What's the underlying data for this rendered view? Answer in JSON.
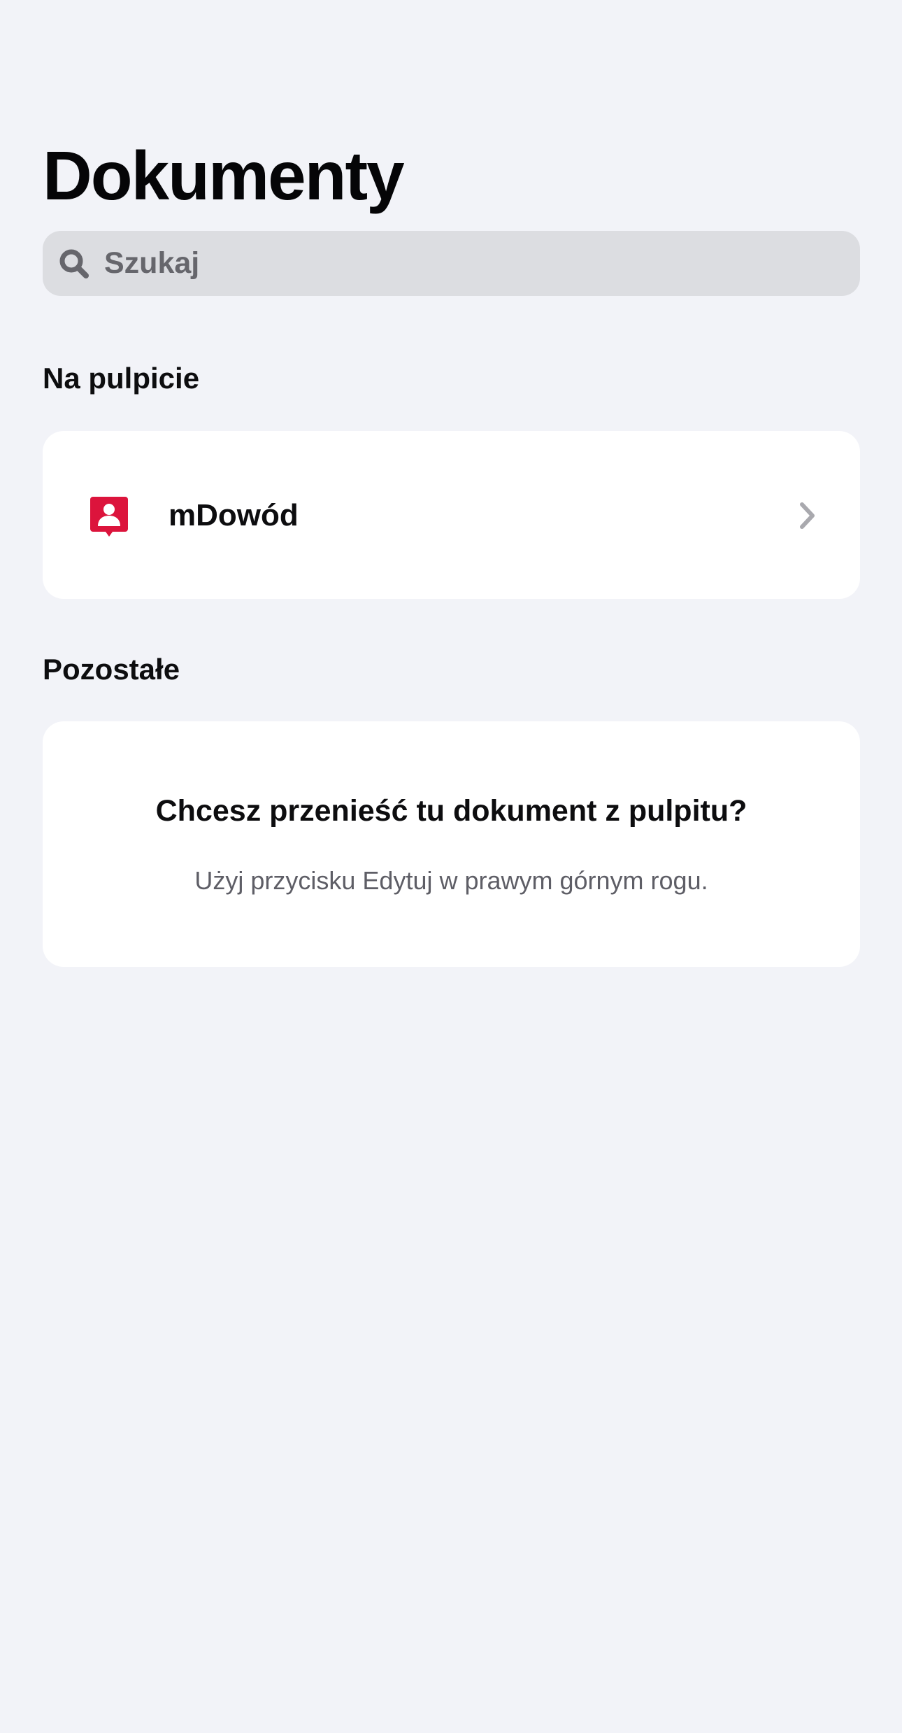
{
  "header": {
    "title": "Dokumenty"
  },
  "search": {
    "placeholder": "Szukaj",
    "value": "",
    "icon": "search-icon"
  },
  "sections": {
    "desktop": {
      "title": "Na pulpicie",
      "items": [
        {
          "label": "mDowód",
          "icon": "id-card-icon",
          "icon_color": "#dc143c",
          "action_icon": "chevron-right-icon"
        }
      ]
    },
    "other": {
      "title": "Pozostałe",
      "empty_state": {
        "title": "Chcesz przenieść tu dokument z pulpitu?",
        "subtitle": "Użyj przycisku Edytuj w prawym górnym rogu."
      }
    }
  },
  "colors": {
    "background": "#f2f3f8",
    "card": "#ffffff",
    "search_bg": "#dcdde1",
    "accent_red": "#dc143c",
    "secondary_text": "#5e5e66"
  }
}
